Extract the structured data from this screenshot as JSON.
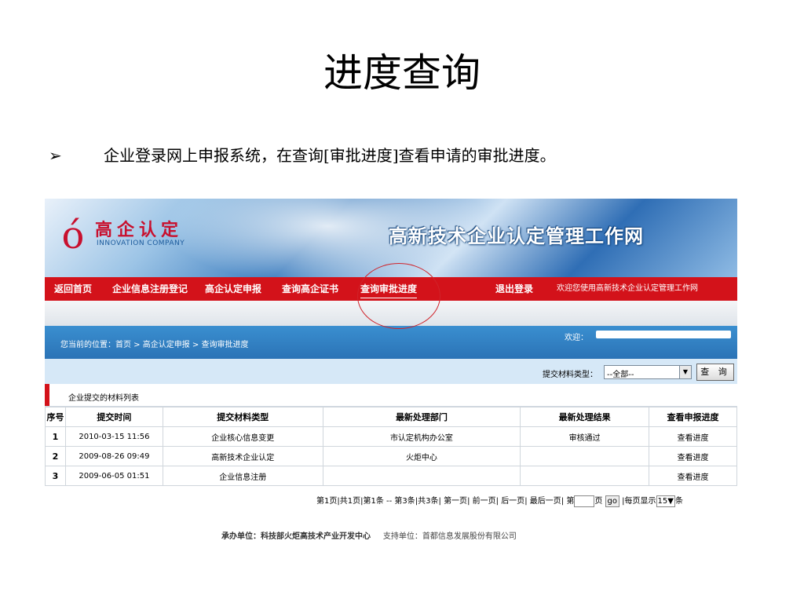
{
  "slide": {
    "title": "进度查询",
    "bullet_symbol": "➢",
    "bullet_text": "企业登录网上申报系统，在查询[审批进度]查看申请的审批进度。"
  },
  "colors": {
    "nav_red": "#d3121a",
    "brand_blue": "#2b73b6",
    "annotation": "#d0232a"
  },
  "banner": {
    "logo_text": "高企认定",
    "logo_sub": "INNOVATION COMPANY",
    "site_name": "高新技术企业认定管理工作网"
  },
  "nav": {
    "items": [
      "返回首页",
      "企业信息注册登记",
      "高企认定申报",
      "查询高企证书",
      "查询审批进度",
      "退出登录"
    ],
    "welcome": "欢迎您使用高新技术企业认定管理工作网"
  },
  "breadcrumb": "您当前的位置：首页 > 高企认定申报 > 查询审批进度",
  "greeting": "欢迎：",
  "filter": {
    "label": "提交材料类型：",
    "selected": "--全部--",
    "query_button": "查 询"
  },
  "list_title": "企业提交的材料列表",
  "table": {
    "headers": [
      "序号",
      "提交时间",
      "提交材料类型",
      "最新处理部门",
      "最新处理结果",
      "查看申报进度"
    ],
    "rows": [
      [
        "1",
        "2010-03-15 11:56",
        "企业核心信息变更",
        "市认定机构办公室",
        "审核通过",
        "查看进度"
      ],
      [
        "2",
        "2009-08-26 09:49",
        "高新技术企业认定",
        "火炬中心",
        "",
        "查看进度"
      ],
      [
        "3",
        "2009-06-05 01:51",
        "企业信息注册",
        "",
        "",
        "查看进度"
      ]
    ]
  },
  "pager": {
    "summary": "第1页|共1页|第1条 -- 第3条|共3条|",
    "first": "第一页",
    "prev": "前一页",
    "next": "后一页",
    "last": "最后一页",
    "goto_prefix": "第",
    "goto_suffix": "页",
    "go": "go",
    "per_page_prefix": "|每页显示",
    "per_page": "15",
    "per_page_suffix": "条"
  },
  "footer": {
    "host": "承办单位：科技部火炬高技术产业开发中心",
    "support": "支持单位：首都信息发展股份有限公司"
  }
}
